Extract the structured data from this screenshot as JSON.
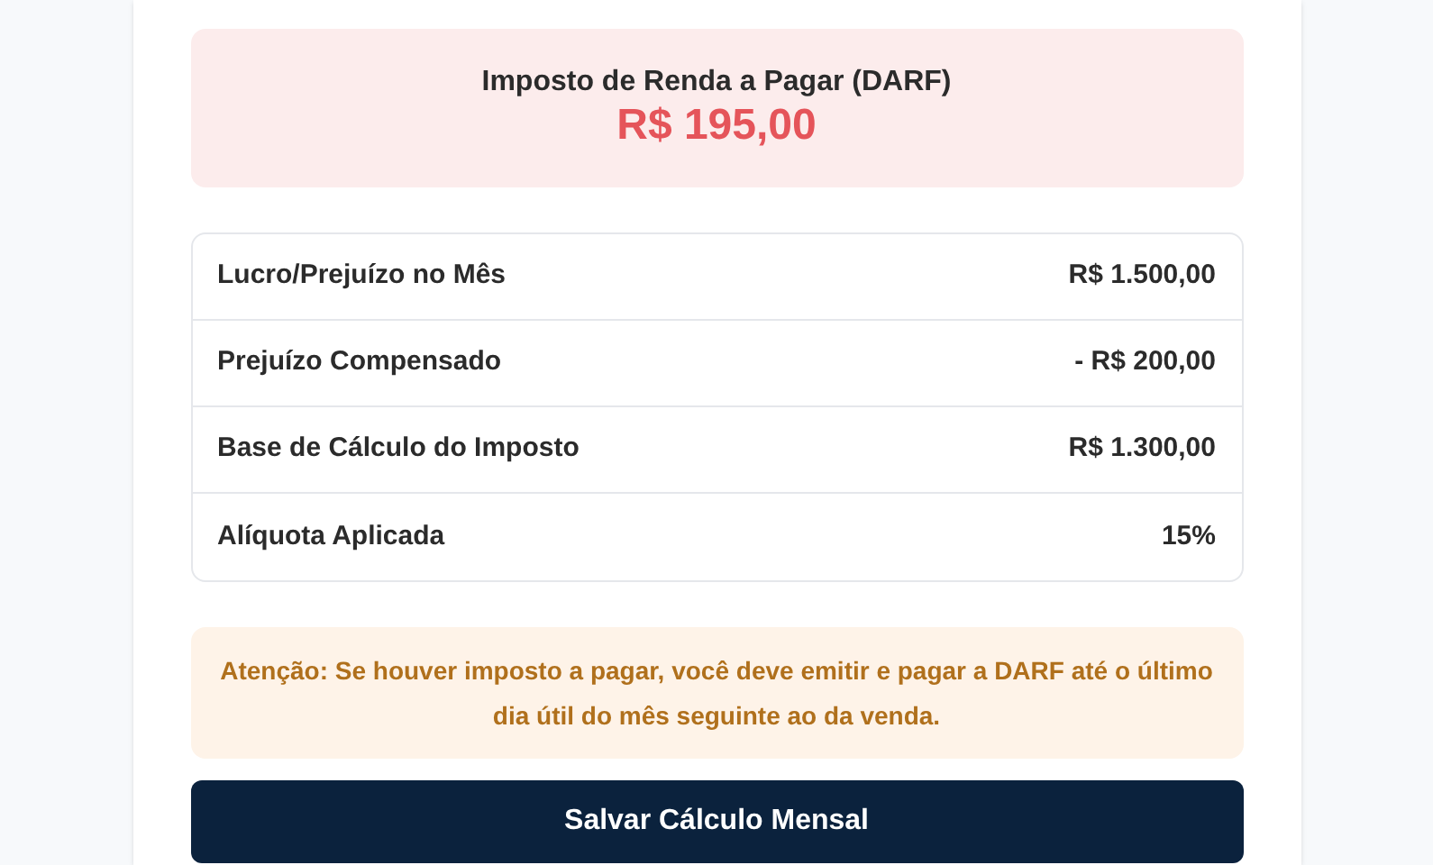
{
  "tax_due": {
    "label": "Imposto de Renda a Pagar (DARF)",
    "amount": "R$ 195,00"
  },
  "summary_rows": [
    {
      "label": "Lucro/Prejuízo no Mês",
      "value": "R$ 1.500,00"
    },
    {
      "label": "Prejuízo Compensado",
      "value": "- R$ 200,00"
    },
    {
      "label": "Base de Cálculo do Imposto",
      "value": "R$ 1.300,00"
    },
    {
      "label": "Alíquota Aplicada",
      "value": "15%"
    }
  ],
  "notice": "**Atenção:** Se houver imposto a pagar, você deve emitir e pagar a DARF até o último dia útil do mês seguinte ao da venda.",
  "save_button": "Salvar Cálculo Mensal"
}
